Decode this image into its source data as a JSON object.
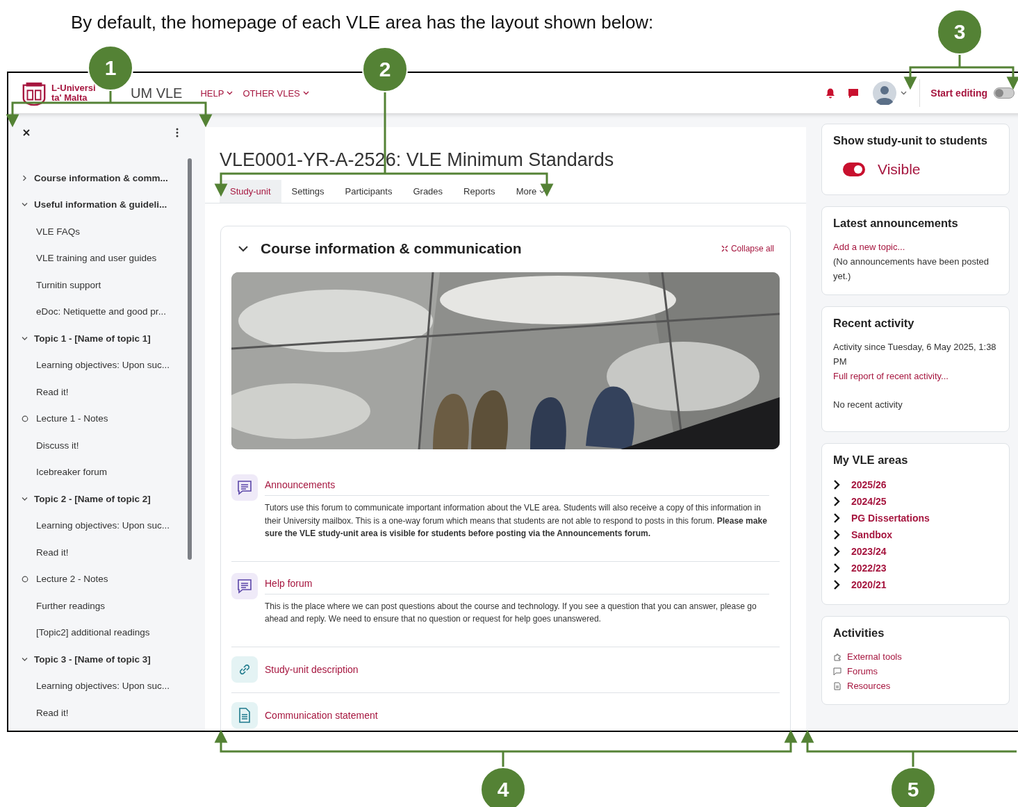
{
  "intro": "By default, the homepage of each VLE area has the layout shown below:",
  "callouts": [
    {
      "number": "1"
    },
    {
      "number": "2"
    },
    {
      "number": "3"
    },
    {
      "number": "4"
    },
    {
      "number": "5"
    }
  ],
  "header": {
    "logo_lines": [
      "L-Universi",
      "ta' Malta"
    ],
    "site_name": "UM VLE",
    "menu": [
      {
        "label": "HELP"
      },
      {
        "label": "OTHER VLES"
      }
    ],
    "edit_mode": {
      "label": "Start editing",
      "on": false
    }
  },
  "sidebar": {
    "items": [
      {
        "label": "Course information & comm...",
        "expanded": false
      },
      {
        "label": "Useful information & guideli...",
        "expanded": true,
        "children": [
          {
            "label": "VLE FAQs",
            "completion": false
          },
          {
            "label": "VLE training and user guides",
            "completion": false
          },
          {
            "label": "Turnitin support",
            "completion": false
          },
          {
            "label": "eDoc: Netiquette and good pr...",
            "completion": false
          }
        ]
      },
      {
        "label": "Topic 1 - [Name of topic 1]",
        "expanded": true,
        "children": [
          {
            "label": "Learning objectives: Upon suc...",
            "completion": false
          },
          {
            "label": "Read it!",
            "completion": false
          },
          {
            "label": "Lecture 1 - Notes",
            "completion": true
          },
          {
            "label": "Discuss it!",
            "completion": false
          },
          {
            "label": "Icebreaker forum",
            "completion": false
          }
        ]
      },
      {
        "label": "Topic 2 - [Name of topic 2]",
        "expanded": true,
        "children": [
          {
            "label": "Learning objectives: Upon suc...",
            "completion": false
          },
          {
            "label": "Read it!",
            "completion": false
          },
          {
            "label": "Lecture 2 - Notes",
            "completion": true
          },
          {
            "label": "Further readings",
            "completion": false
          },
          {
            "label": "[Topic2] additional readings",
            "completion": false
          }
        ]
      },
      {
        "label": "Topic 3 - [Name of topic 3]",
        "expanded": true,
        "children": [
          {
            "label": "Learning objectives: Upon suc...",
            "completion": false
          },
          {
            "label": "Read it!",
            "completion": false
          }
        ]
      }
    ]
  },
  "course": {
    "title": "VLE0001-YR-A-2526: VLE Minimum Standards",
    "tabs": [
      {
        "label": "Study-unit",
        "selected": true
      },
      {
        "label": "Settings",
        "selected": false
      },
      {
        "label": "Participants",
        "selected": false
      },
      {
        "label": "Grades",
        "selected": false
      },
      {
        "label": "Reports",
        "selected": false
      },
      {
        "label": "More",
        "selected": false
      }
    ],
    "section": {
      "title": "Course information & communication",
      "expanded": true,
      "collapse_label": "Collapse all",
      "activities": [
        {
          "kind": "forum",
          "name": "Announcements",
          "description": "Tutors use this forum to communicate important information about the VLE area. Students will also receive a copy of this information in their University mailbox. This is a one-way forum which means that students are not able to respond to posts in this forum. **Please make sure the VLE study-unit area is visible for students before posting via the Announcements forum.**"
        },
        {
          "kind": "forum",
          "name": "Help forum",
          "description": "This is the place where we can post questions about the course and technology. If you see a question that you can answer, please go ahead and reply. We need to ensure that no question or request for help goes unanswered."
        },
        {
          "kind": "url",
          "name": "Study-unit description"
        },
        {
          "kind": "file",
          "name": "Communication statement"
        }
      ]
    }
  },
  "blocks": [
    {
      "kind": "visibility",
      "title": "Show study-unit to students",
      "label": "Visible",
      "on": true
    },
    {
      "kind": "announcements",
      "title": "Latest announcements",
      "link": "Add a new topic...",
      "text": "(No announcements have been posted yet.)"
    },
    {
      "kind": "recent",
      "title": "Recent activity",
      "since": "Activity since Tuesday, 6 May 2025, 1:38 PM",
      "link": "Full report of recent activity...",
      "empty": "No recent activity"
    },
    {
      "kind": "areas",
      "title": "My VLE areas",
      "items": [
        "2025/26",
        "2024/25",
        "PG Dissertations",
        "Sandbox",
        "2023/24",
        "2022/23",
        "2020/21"
      ]
    },
    {
      "kind": "activities",
      "title": "Activities",
      "items": [
        {
          "kind": "tool",
          "label": "External tools"
        },
        {
          "kind": "forum",
          "label": "Forums"
        },
        {
          "kind": "resource",
          "label": "Resources"
        }
      ]
    }
  ]
}
